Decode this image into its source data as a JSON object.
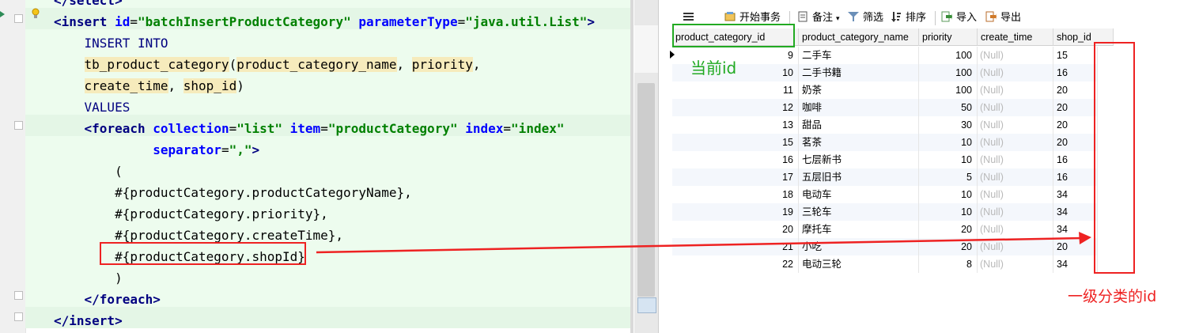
{
  "editor": {
    "lines": [
      {
        "segments": [
          {
            "t": "</",
            "c": "tag"
          },
          {
            "t": "select",
            "c": "tag"
          },
          {
            "t": ">",
            "c": "tag"
          }
        ]
      },
      {
        "segments": [
          {
            "t": "<",
            "c": "tag"
          },
          {
            "t": "insert",
            "c": "tag"
          },
          {
            "t": " ",
            "c": "sep"
          },
          {
            "t": "id",
            "c": "attr"
          },
          {
            "t": "=",
            "c": "sep"
          },
          {
            "t": "\"batchInsertProductCategory\"",
            "c": "val"
          },
          {
            "t": " ",
            "c": "sep"
          },
          {
            "t": "parameterType",
            "c": "attr"
          },
          {
            "t": "=",
            "c": "sep"
          },
          {
            "t": "\"java.util.List\"",
            "c": "val"
          },
          {
            "t": ">",
            "c": "tag"
          }
        ]
      },
      {
        "segments": [
          {
            "t": "    INSERT INTO",
            "c": "kw"
          }
        ]
      },
      {
        "segments": [
          {
            "t": "    ",
            "c": "sep"
          },
          {
            "t": "tb_product_category",
            "c": "col"
          },
          {
            "t": "(",
            "c": "sep"
          },
          {
            "t": "product_category_name",
            "c": "col"
          },
          {
            "t": ", ",
            "c": "sep"
          },
          {
            "t": "priority",
            "c": "col"
          },
          {
            "t": ",",
            "c": "sep"
          }
        ]
      },
      {
        "segments": [
          {
            "t": "    ",
            "c": "sep"
          },
          {
            "t": "create_time",
            "c": "col"
          },
          {
            "t": ", ",
            "c": "sep"
          },
          {
            "t": "shop_id",
            "c": "col"
          },
          {
            "t": ")",
            "c": "sep"
          }
        ]
      },
      {
        "segments": [
          {
            "t": "    VALUES",
            "c": "kw"
          }
        ]
      },
      {
        "segments": [
          {
            "t": "    <",
            "c": "tag"
          },
          {
            "t": "foreach",
            "c": "tag"
          },
          {
            "t": " ",
            "c": "sep"
          },
          {
            "t": "collection",
            "c": "attr"
          },
          {
            "t": "=",
            "c": "sep"
          },
          {
            "t": "\"list\"",
            "c": "val"
          },
          {
            "t": " ",
            "c": "sep"
          },
          {
            "t": "item",
            "c": "attr"
          },
          {
            "t": "=",
            "c": "sep"
          },
          {
            "t": "\"productCategory\"",
            "c": "val"
          },
          {
            "t": " ",
            "c": "sep"
          },
          {
            "t": "index",
            "c": "attr"
          },
          {
            "t": "=",
            "c": "sep"
          },
          {
            "t": "\"index\"",
            "c": "val"
          }
        ]
      },
      {
        "segments": [
          {
            "t": "             ",
            "c": "sep"
          },
          {
            "t": "separator",
            "c": "attr"
          },
          {
            "t": "=",
            "c": "sep"
          },
          {
            "t": "\",\"",
            "c": "val"
          },
          {
            "t": ">",
            "c": "tag"
          }
        ]
      },
      {
        "segments": [
          {
            "t": "        (",
            "c": "sep"
          }
        ]
      },
      {
        "segments": [
          {
            "t": "        #{productCategory.productCategoryName},",
            "c": "sep"
          }
        ]
      },
      {
        "segments": [
          {
            "t": "        #{productCategory.priority},",
            "c": "sep"
          }
        ]
      },
      {
        "segments": [
          {
            "t": "        #{productCategory.createTime},",
            "c": "sep"
          }
        ]
      },
      {
        "segments": [
          {
            "t": "        #{productCategory.shopId}",
            "c": "sep"
          }
        ]
      },
      {
        "segments": [
          {
            "t": "        )",
            "c": "sep"
          }
        ]
      },
      {
        "segments": [
          {
            "t": "    </",
            "c": "tag"
          },
          {
            "t": "foreach",
            "c": "tag"
          },
          {
            "t": ">",
            "c": "tag"
          }
        ]
      },
      {
        "segments": [
          {
            "t": "</",
            "c": "tag"
          },
          {
            "t": "insert",
            "c": "tag"
          },
          {
            "t": ">",
            "c": "tag"
          }
        ]
      }
    ]
  },
  "toolbar": {
    "menu_icon": "hamburger-icon",
    "begin_transaction": "开始事务",
    "notes": "备注",
    "filter": "筛选",
    "sort": "排序",
    "import": "导入",
    "export": "导出"
  },
  "table": {
    "columns": [
      "product_category_id",
      "product_category_name",
      "priority",
      "create_time",
      "shop_id"
    ],
    "rows": [
      {
        "id": "9",
        "name": "二手车",
        "priority": "100",
        "create_time": "(Null)",
        "shop_id": "15"
      },
      {
        "id": "10",
        "name": "二手书籍",
        "priority": "100",
        "create_time": "(Null)",
        "shop_id": "16"
      },
      {
        "id": "11",
        "name": "奶茶",
        "priority": "100",
        "create_time": "(Null)",
        "shop_id": "20"
      },
      {
        "id": "12",
        "name": "咖啡",
        "priority": "50",
        "create_time": "(Null)",
        "shop_id": "20"
      },
      {
        "id": "13",
        "name": "甜品",
        "priority": "30",
        "create_time": "(Null)",
        "shop_id": "20"
      },
      {
        "id": "15",
        "name": "茗茶",
        "priority": "10",
        "create_time": "(Null)",
        "shop_id": "20"
      },
      {
        "id": "16",
        "name": "七层新书",
        "priority": "10",
        "create_time": "(Null)",
        "shop_id": "16"
      },
      {
        "id": "17",
        "name": "五层旧书",
        "priority": "5",
        "create_time": "(Null)",
        "shop_id": "16"
      },
      {
        "id": "18",
        "name": "电动车",
        "priority": "10",
        "create_time": "(Null)",
        "shop_id": "34"
      },
      {
        "id": "19",
        "name": "三轮车",
        "priority": "10",
        "create_time": "(Null)",
        "shop_id": "34"
      },
      {
        "id": "20",
        "name": "摩托车",
        "priority": "20",
        "create_time": "(Null)",
        "shop_id": "34"
      },
      {
        "id": "21",
        "name": "小吃",
        "priority": "20",
        "create_time": "(Null)",
        "shop_id": "20"
      },
      {
        "id": "22",
        "name": "电动三轮",
        "priority": "8",
        "create_time": "(Null)",
        "shop_id": "34"
      }
    ]
  },
  "annotations": {
    "current_id_label": "当前id",
    "first_level_category_label": "一级分类的id",
    "green_color": "#22aa22",
    "red_color": "#ee2222"
  }
}
